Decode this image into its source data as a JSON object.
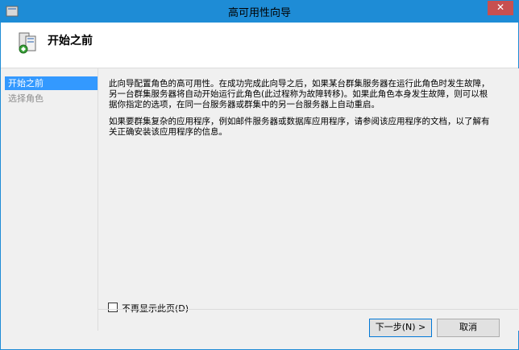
{
  "window": {
    "title": "高可用性向导",
    "close_glyph": "✕"
  },
  "header": {
    "title": "开始之前"
  },
  "nav": {
    "items": [
      {
        "label": "开始之前"
      },
      {
        "label": "选择角色"
      }
    ]
  },
  "content": {
    "paragraph1": "此向导配置角色的高可用性。在成功完成此向导之后，如果某台群集服务器在运行此角色时发生故障，另一台群集服务器将自动开始运行此角色(此过程称为故障转移)。如果此角色本身发生故障，则可以根据你指定的选项，在同一台服务器或群集中的另一台服务器上自动重启。",
    "paragraph2": "如果要群集复杂的应用程序，例如邮件服务器或数据库应用程序，请参阅该应用程序的文档，以了解有关正确安装该应用程序的信息。",
    "checkbox_label": "不再显示此页(D)"
  },
  "buttons": {
    "next": "下一步(N) >",
    "cancel": "取消"
  },
  "colors": {
    "titlebar": "#1e8cd6",
    "selected": "#3399ff",
    "close": "#c75050"
  }
}
